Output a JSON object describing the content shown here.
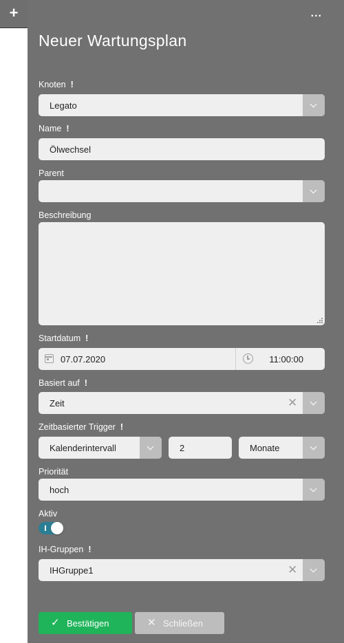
{
  "toolbar": {
    "add_icon": "plus-icon",
    "more_icon": "more-dots-icon"
  },
  "form": {
    "title": "Neuer Wartungsplan",
    "required_mark": "❕",
    "knoten": {
      "label": "Knoten",
      "value": "Legato"
    },
    "name": {
      "label": "Name",
      "value": "Ölwechsel"
    },
    "parent": {
      "label": "Parent",
      "value": ""
    },
    "beschreibung": {
      "label": "Beschreibung",
      "value": ""
    },
    "startdatum": {
      "label": "Startdatum",
      "date": "07.07.2020",
      "time": "11:00:00"
    },
    "basiert_auf": {
      "label": "Basiert auf",
      "value": "Zeit"
    },
    "trigger": {
      "label": "Zeitbasierter Trigger",
      "type": "Kalenderintervall",
      "count": "2",
      "unit": "Monate"
    },
    "prioritaet": {
      "label": "Priorität",
      "value": "hoch"
    },
    "aktiv": {
      "label": "Aktiv",
      "on": true
    },
    "ih_gruppen": {
      "label": "IH-Gruppen",
      "value": "IHGruppe1"
    }
  },
  "buttons": {
    "confirm": "Bestätigen",
    "close": "Schließen"
  },
  "colors": {
    "panel": "#717171",
    "field": "#efefef",
    "accent_green": "#1fb45a",
    "toggle": "#2a7f95"
  }
}
